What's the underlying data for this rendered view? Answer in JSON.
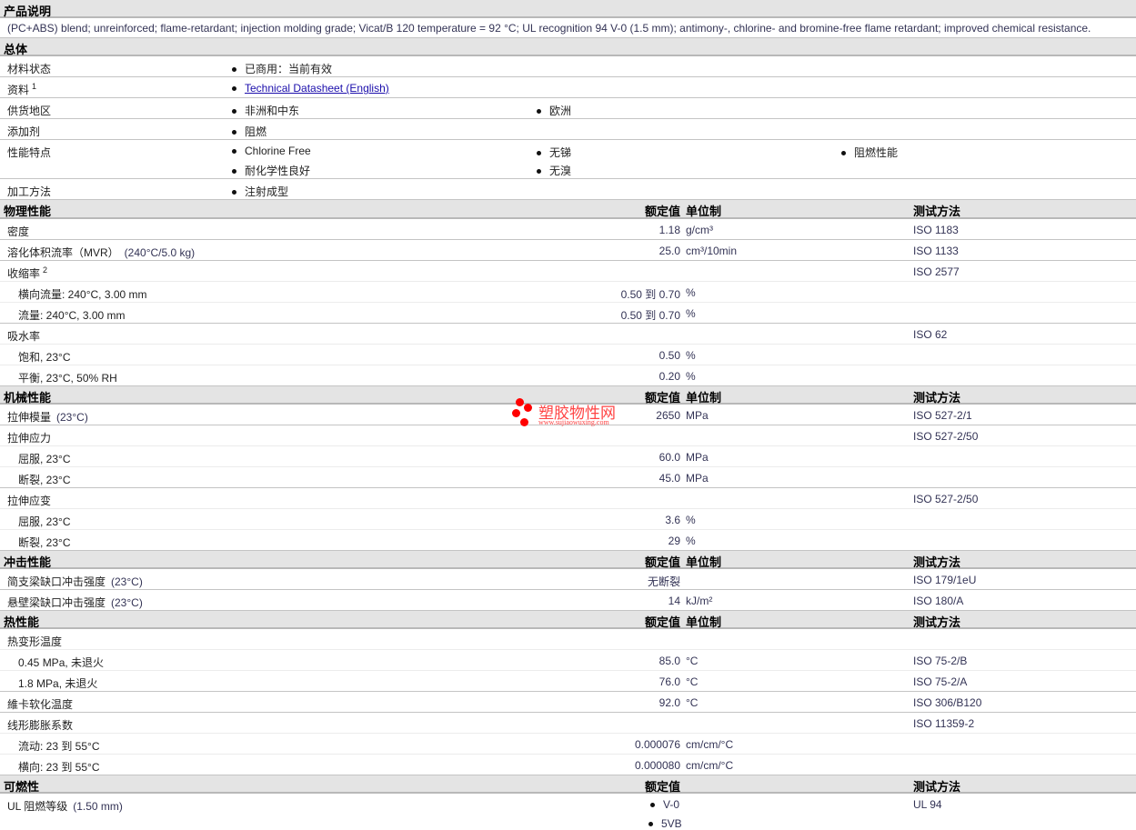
{
  "product_description": {
    "title": "产品说明",
    "text": "(PC+ABS) blend; unreinforced; flame-retardant; injection molding grade; Vicat/B 120 temperature = 92 °C; UL recognition 94 V-0 (1.5 mm); antimony-, chlorine- and bromine-free flame retardant; improved chemical resistance."
  },
  "general": {
    "title": "总体",
    "rows": [
      {
        "label": "材料状态",
        "items": [
          "已商用：当前有效"
        ]
      },
      {
        "label": "资料",
        "sup": "1",
        "items": [
          "Technical Datasheet (English)"
        ],
        "link": true
      },
      {
        "label": "供货地区",
        "items": [
          "非洲和中东",
          "欧洲"
        ]
      },
      {
        "label": "添加剂",
        "items": [
          "阻燃"
        ]
      },
      {
        "label": "性能特点",
        "items": [
          "Chlorine Free",
          "无锑",
          "阻燃性能",
          "耐化学性良好",
          "无溴"
        ]
      },
      {
        "label": "加工方法",
        "items": [
          "注射成型"
        ]
      }
    ]
  },
  "columns": {
    "value": "额定值",
    "unit": "单位制",
    "method": "测试方法"
  },
  "sections": [
    {
      "title": "物理性能",
      "rows": [
        {
          "label": "密度",
          "value": "1.18",
          "unit": "g/cm³",
          "method": "ISO 1183"
        },
        {
          "label": "溶化体积流率（MVR）",
          "paren": "(240°C/5.0 kg)",
          "value": "25.0",
          "unit": "cm³/10min",
          "method": "ISO 1133"
        },
        {
          "label": "收缩率",
          "sup": "2",
          "method": "ISO 2577",
          "minor": true
        },
        {
          "label": "横向流量: 240°C, 3.00 mm",
          "sub": true,
          "value": "0.50 到  0.70",
          "unit": "%",
          "minor": true
        },
        {
          "label": "流量: 240°C, 3.00 mm",
          "sub": true,
          "value": "0.50 到  0.70",
          "unit": "%"
        },
        {
          "label": "吸水率",
          "method": "ISO 62",
          "minor": true
        },
        {
          "label": "饱和, 23°C",
          "sub": true,
          "value": "0.50",
          "unit": "%",
          "minor": true
        },
        {
          "label": "平衡, 23°C, 50% RH",
          "sub": true,
          "value": "0.20",
          "unit": "%"
        }
      ]
    },
    {
      "title": "机械性能",
      "rows": [
        {
          "label": "拉伸模量",
          "paren": "(23°C)",
          "value": "2650",
          "unit": "MPa",
          "method": "ISO 527-2/1"
        },
        {
          "label": "拉伸应力",
          "method": "ISO 527-2/50",
          "minor": true
        },
        {
          "label": "屈服, 23°C",
          "sub": true,
          "value": "60.0",
          "unit": "MPa",
          "minor": true
        },
        {
          "label": "断裂, 23°C",
          "sub": true,
          "value": "45.0",
          "unit": "MPa"
        },
        {
          "label": "拉伸应变",
          "method": "ISO 527-2/50",
          "minor": true
        },
        {
          "label": "屈服, 23°C",
          "sub": true,
          "value": "3.6",
          "unit": "%",
          "minor": true
        },
        {
          "label": "断裂, 23°C",
          "sub": true,
          "value": "29",
          "unit": "%"
        }
      ]
    },
    {
      "title": "冲击性能",
      "rows": [
        {
          "label": "简支梁缺口冲击强度",
          "paren": "(23°C)",
          "value": "无断裂",
          "method": "ISO 179/1eU"
        },
        {
          "label": "悬壁梁缺口冲击强度",
          "paren": "(23°C)",
          "value": "14",
          "unit": "kJ/m²",
          "method": "ISO 180/A"
        }
      ]
    },
    {
      "title": "热性能",
      "rows": [
        {
          "label": "热变形温度",
          "minor": true
        },
        {
          "label": "0.45 MPa, 未退火",
          "sub": true,
          "value": "85.0",
          "unit": "°C",
          "method": "ISO 75-2/B",
          "minor": true
        },
        {
          "label": "1.8 MPa, 未退火",
          "sub": true,
          "value": "76.0",
          "unit": "°C",
          "method": "ISO 75-2/A"
        },
        {
          "label": "維卡软化温度",
          "value": "92.0",
          "unit": "°C",
          "method": "ISO 306/B120"
        },
        {
          "label": "线形膨胀系数",
          "method": "ISO 11359-2",
          "minor": true
        },
        {
          "label": "流动: 23 到  55°C",
          "sub": true,
          "value": "0.000076",
          "unit": "cm/cm/°C",
          "minor": true
        },
        {
          "label": "横向: 23 到  55°C",
          "sub": true,
          "value": "0.000080",
          "unit": "cm/cm/°C"
        }
      ]
    }
  ],
  "flammability": {
    "title": "可燃性",
    "value_header": "额定值",
    "method_header": "测试方法",
    "label": "UL 阻燃等级",
    "paren": "(1.50 mm)",
    "values": [
      "V-0",
      "5VB"
    ],
    "method": "UL 94"
  },
  "watermark": {
    "title": "塑胶物性网",
    "url": "www.sujiaowuxing.com"
  }
}
